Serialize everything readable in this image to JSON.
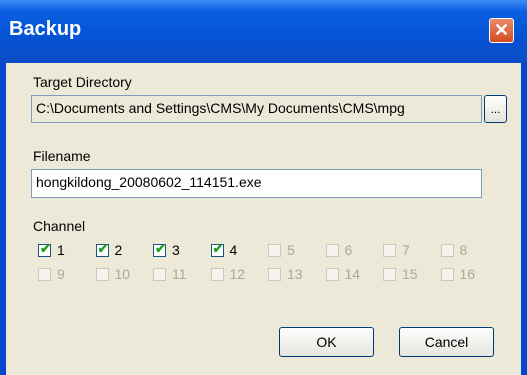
{
  "window": {
    "title": "Backup"
  },
  "target_directory": {
    "label": "Target Directory",
    "value": "C:\\Documents and Settings\\CMS\\My Documents\\CMS\\mpg",
    "browse_label": "..."
  },
  "filename": {
    "label": "Filename",
    "value": "hongkildong_20080602_114151.exe"
  },
  "channel": {
    "label": "Channel",
    "items": [
      {
        "label": "1",
        "checked": true,
        "enabled": true
      },
      {
        "label": "2",
        "checked": true,
        "enabled": true
      },
      {
        "label": "3",
        "checked": true,
        "enabled": true
      },
      {
        "label": "4",
        "checked": true,
        "enabled": true
      },
      {
        "label": "5",
        "checked": false,
        "enabled": false
      },
      {
        "label": "6",
        "checked": false,
        "enabled": false
      },
      {
        "label": "7",
        "checked": false,
        "enabled": false
      },
      {
        "label": "8",
        "checked": false,
        "enabled": false
      },
      {
        "label": "9",
        "checked": false,
        "enabled": false
      },
      {
        "label": "10",
        "checked": false,
        "enabled": false
      },
      {
        "label": "11",
        "checked": false,
        "enabled": false
      },
      {
        "label": "12",
        "checked": false,
        "enabled": false
      },
      {
        "label": "13",
        "checked": false,
        "enabled": false
      },
      {
        "label": "14",
        "checked": false,
        "enabled": false
      },
      {
        "label": "15",
        "checked": false,
        "enabled": false
      },
      {
        "label": "16",
        "checked": false,
        "enabled": false
      }
    ]
  },
  "buttons": {
    "ok": "OK",
    "cancel": "Cancel"
  },
  "colors": {
    "titlebar": "#0553d6",
    "dialog_bg": "#ece9d8",
    "close": "#d44a1f",
    "check": "#21a121"
  }
}
